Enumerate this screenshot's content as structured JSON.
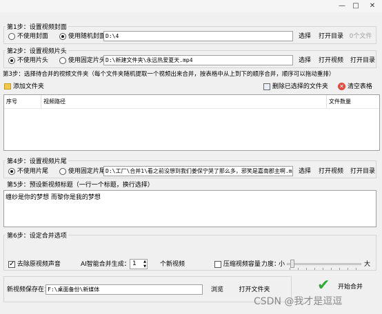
{
  "window": {
    "min": "—",
    "max": "□",
    "close": "✕"
  },
  "step1": {
    "title": "第1步：设置视频封面",
    "opt_none": "不使用封面",
    "opt_random": "使用随机封面",
    "path": "D:\\4",
    "select": "选择",
    "open_dir": "打开目录",
    "count": "0个文件"
  },
  "step2": {
    "title": "第2步：设置视频片头",
    "opt_none": "不使用片头",
    "opt_fixed": "使用固定片头",
    "path": "D:\\新建文件夹\\永远热爱夏天.mp4",
    "select": "选择",
    "open_video": "打开视频",
    "open_dir": "打开目录"
  },
  "step3": {
    "title": "第3步：选择待合并的视频文件夹（每个文件夹随机提取一个视频出来合并，按表格中从上到下的顺序合并，顺序可以拖动重排）",
    "add_folder": "添加文件夹",
    "delete_selected": "删除已选择的文件夹",
    "clear_table": "清空表格",
    "columns": [
      "序号",
      "视频路径",
      "文件数量"
    ]
  },
  "step4": {
    "title": "第4步：设置视频片尾",
    "opt_none": "不使用片尾",
    "opt_fixed": "使用固定片尾",
    "path": "D:\\工厂\\合并1\\看之前没想到我们姜保宁哭了那么多，邪笑是嘉南郡主啊.mp4",
    "select": "选择",
    "open_video": "打开视频",
    "open_dir": "打开目录"
  },
  "step5": {
    "title": "第5步：预设新视频标题（一行一个标题，换行选择）",
    "text": "缠纱是你的梦想 而黎你是我的梦想"
  },
  "step6": {
    "title": "第6步：设定合并选项",
    "remove_audio": "去除原视频声音",
    "ai_label": "AI智能合并生成：",
    "ai_value": "1",
    "ai_unit": "个新视频",
    "compress": "压缩视频容量",
    "strength": "力度：",
    "small": "小",
    "large": "大",
    "strength_level": 0.05
  },
  "save": {
    "label": "新视频保存在：",
    "path": "F:\\桌面备份\\新媒体",
    "browse": "浏览",
    "open_folder": "打开文件夹",
    "start": "开始合并"
  },
  "watermark": "CSDN @我才是逗逗"
}
